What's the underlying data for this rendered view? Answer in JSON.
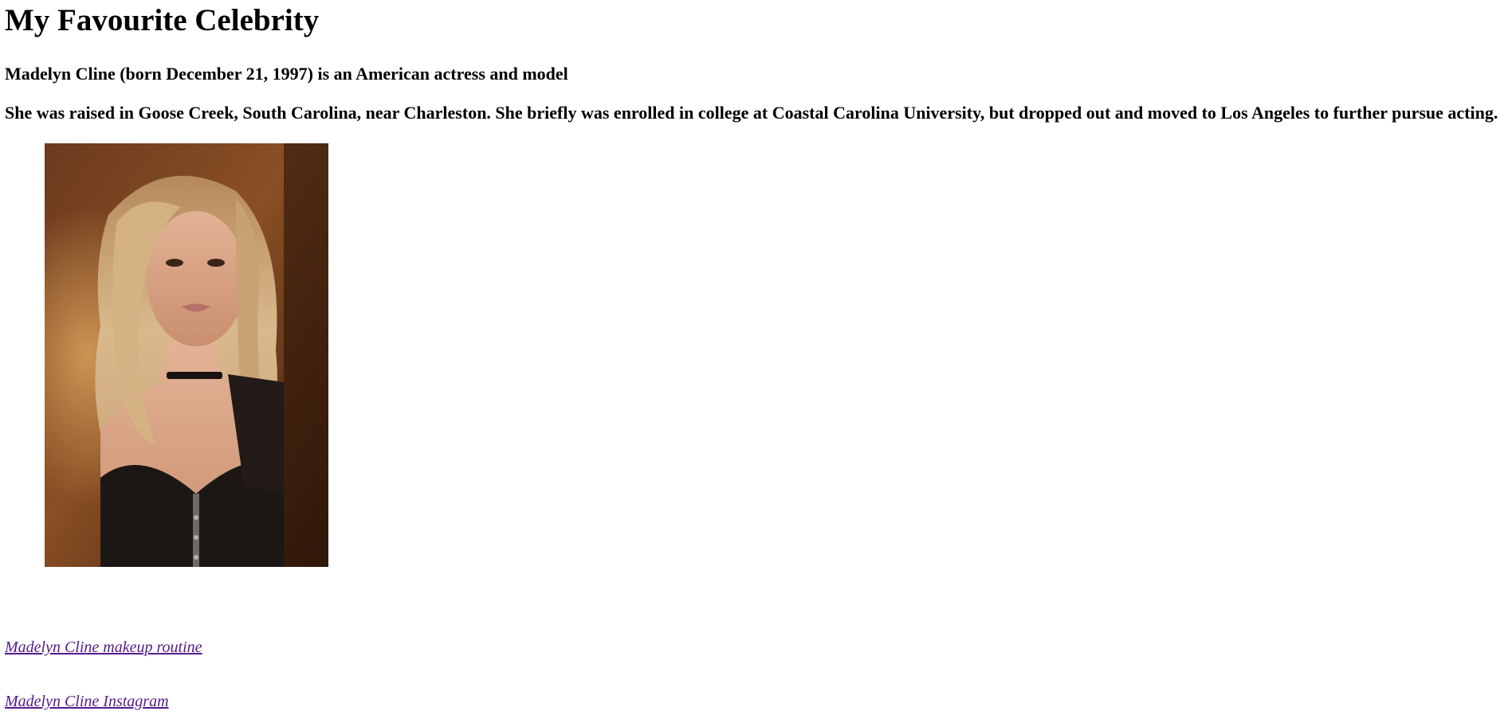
{
  "page": {
    "title": "My Favourite Celebrity",
    "subtitle": "Madelyn Cline (born December 21, 1997) is an American actress and model",
    "bio": "She was raised in Goose Creek, South Carolina, near Charleston. She briefly was enrolled in college at Coastal Carolina University, but dropped out and moved to Los Angeles to further pursue acting."
  },
  "links": {
    "makeup": "Madelyn Cline makeup routine",
    "instagram": "Madelyn Cline Instagram"
  },
  "colors": {
    "link_visited": "#551a8b",
    "text": "#000000",
    "background": "#ffffff"
  }
}
